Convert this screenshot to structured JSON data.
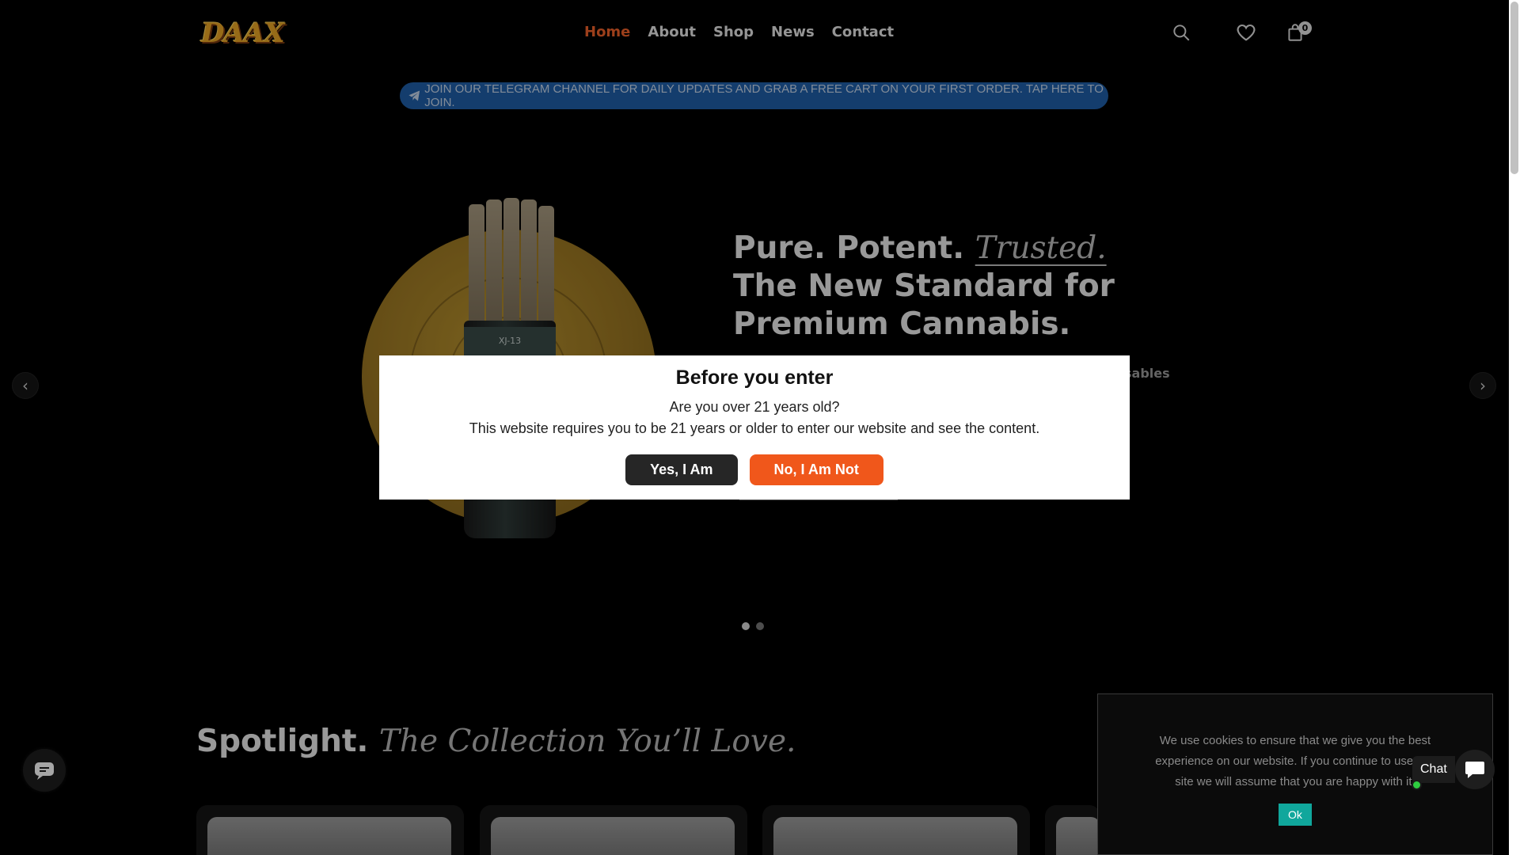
{
  "header": {
    "logo_text": "DAAX",
    "nav": [
      {
        "label": "Home",
        "active": true
      },
      {
        "label": "About",
        "active": false
      },
      {
        "label": "Shop",
        "active": false
      },
      {
        "label": "News",
        "active": false
      },
      {
        "label": "Contact",
        "active": false
      }
    ],
    "icons": [
      "search-icon",
      "heart-icon",
      "cart-icon"
    ],
    "cart_count": "0"
  },
  "telegram_banner": {
    "text": "JOIN OUR TELEGRAM CHANNEL FOR DAILY UPDATES AND GRAB A FREE CART ON YOUR FIRST ORDER. TAP HERE TO JOIN.",
    "icon": "telegram-icon"
  },
  "hero": {
    "title_part1": "Pure. Potent. ",
    "title_emphasis": "Trusted.",
    "title_part2": " The New Standard for Premium Cannabis.",
    "subtitle_fragment": "sables",
    "product_label": "XJ-13",
    "slides": 2,
    "active_slide": 1
  },
  "age_gate": {
    "title": "Before you enter",
    "question": "Are you over 21 years old?",
    "description": "This website requires you to be 21 years or older to enter our website and see the content.",
    "yes_label": "Yes, I Am",
    "no_label": "No, I Am Not"
  },
  "spotlight": {
    "title": "Spotlight.",
    "subtitle": "The Collection You’ll Love."
  },
  "cookie": {
    "text": "We use cookies to ensure that we give you the best experience on our website. If you continue to use this site we will assume that you are happy with it.",
    "ok_label": "Ok"
  },
  "chat": {
    "label": "Chat"
  },
  "colors": {
    "accent": "#f0612a",
    "no_button": "#f0571b",
    "telegram": "#1f5fa8",
    "cookie_ok": "#10a79c"
  }
}
